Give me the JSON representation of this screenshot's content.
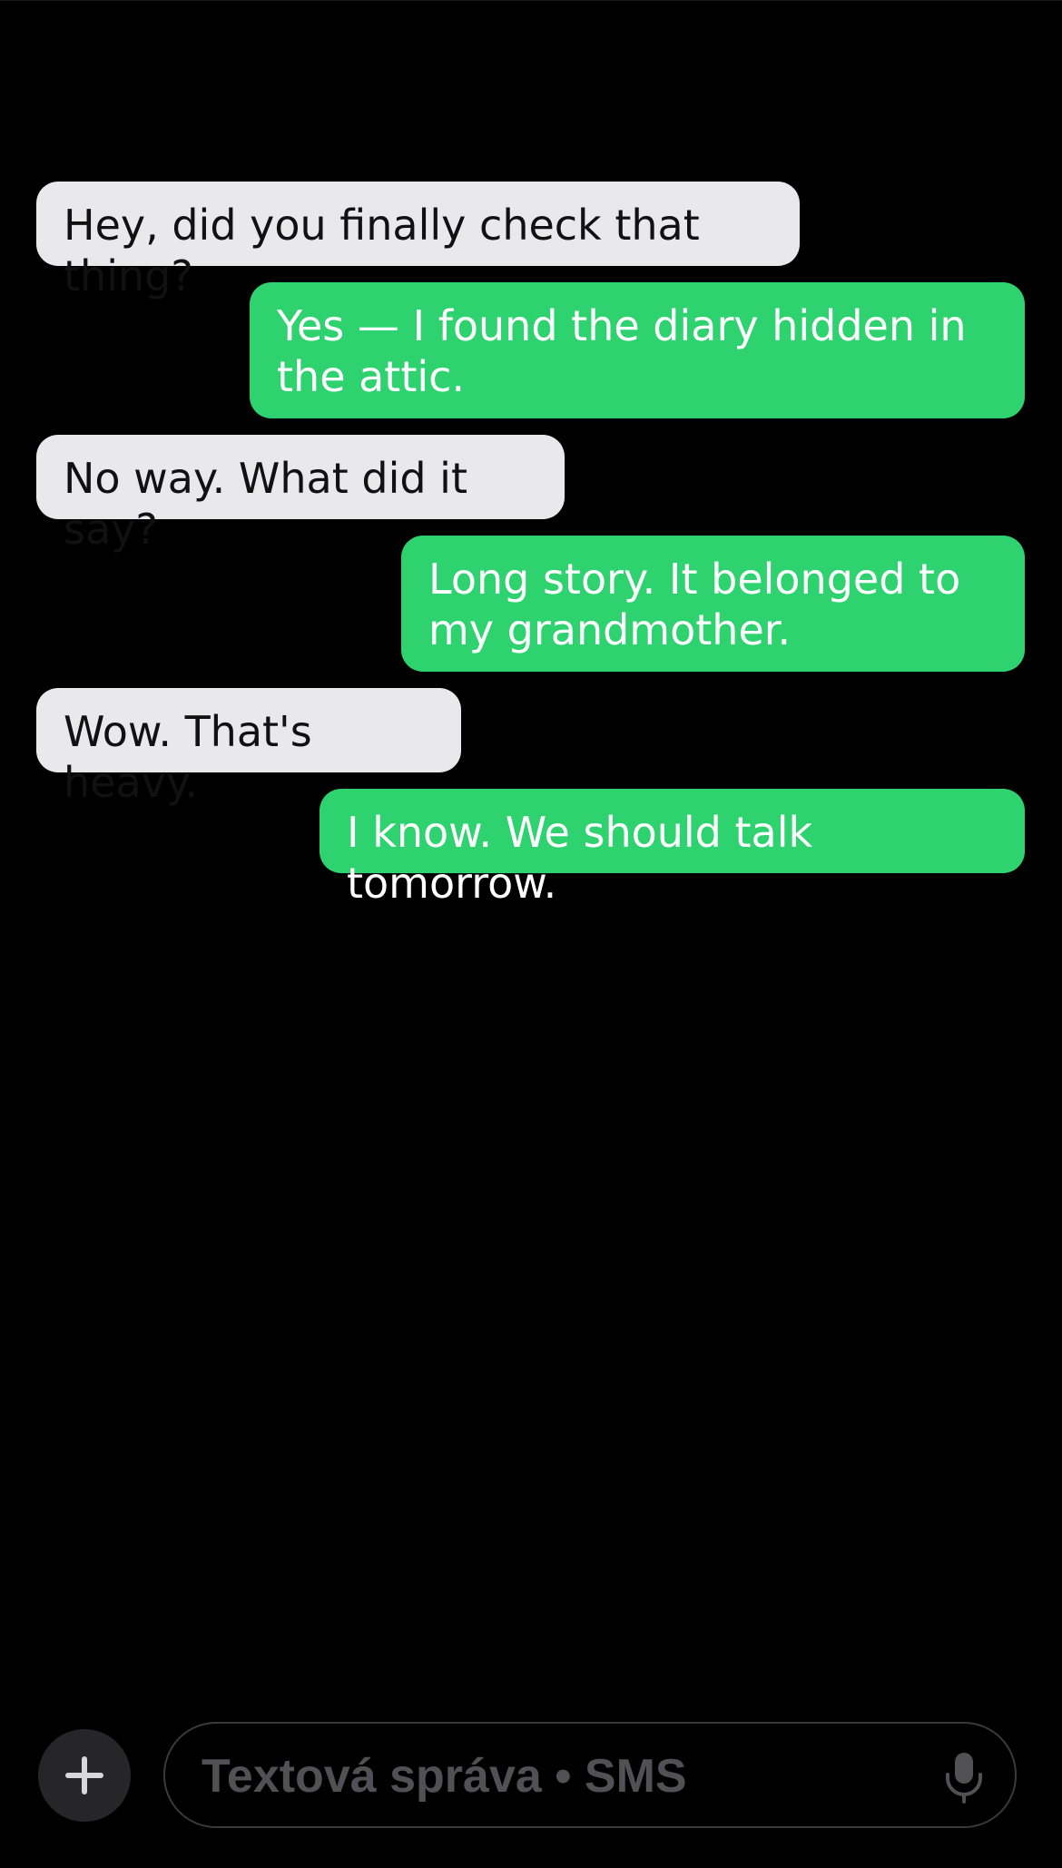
{
  "messages": [
    {
      "direction": "incoming",
      "text": "Hey, did you finally check that thing?"
    },
    {
      "direction": "outgoing",
      "text": "Yes — I found the diary hidden in the attic."
    },
    {
      "direction": "incoming",
      "text": "No way. What did it say?"
    },
    {
      "direction": "outgoing",
      "text": "Long story. It belonged to my grandmother."
    },
    {
      "direction": "incoming",
      "text": "Wow. That's heavy."
    },
    {
      "direction": "outgoing",
      "text": "I know. We should talk tomorrow."
    }
  ],
  "composer": {
    "placeholder": "Textová správa • SMS",
    "add_icon": "plus-icon",
    "mic_icon": "microphone-icon"
  },
  "colors": {
    "background": "#000000",
    "incoming_bubble": "#e9e9eb",
    "outgoing_bubble": "#2ed36f"
  }
}
